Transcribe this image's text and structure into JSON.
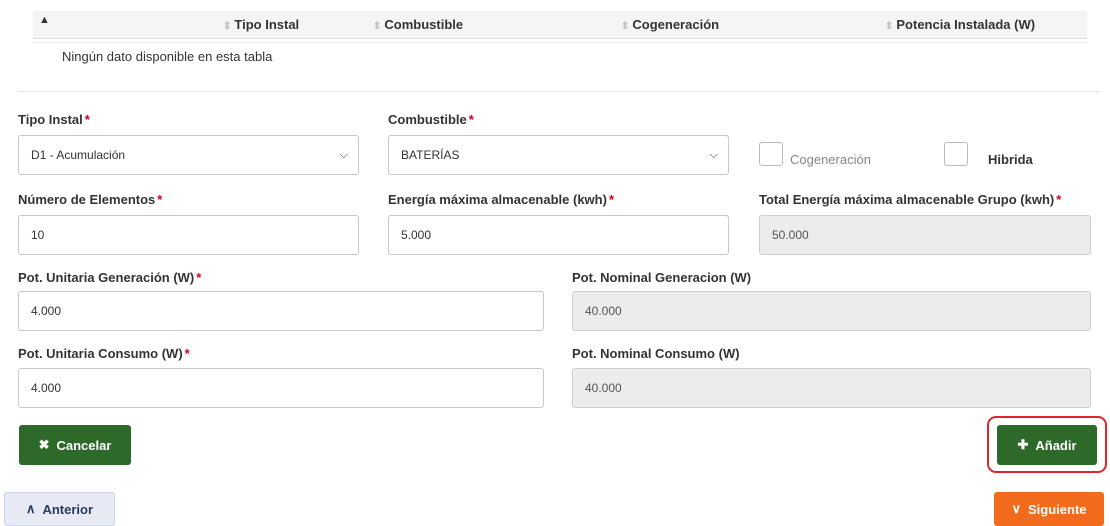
{
  "table": {
    "columns": [
      "Tipo Instal",
      "Combustible",
      "Cogeneración",
      "Potencia Instalada (W)"
    ],
    "empty_message": "Ningún dato disponible en esta tabla"
  },
  "form": {
    "tipo_instal": {
      "label": "Tipo Instal",
      "value": "D1 - Acumulación"
    },
    "combustible": {
      "label": "Combustible",
      "value": "BATERÍAS"
    },
    "cogeneracion": {
      "label": "Cogeneración",
      "checked": false
    },
    "hibrida": {
      "label": "Hibrida",
      "checked": false
    },
    "numero_elementos": {
      "label": "Número de Elementos",
      "value": "10"
    },
    "energia_maxima": {
      "label": "Energía máxima almacenable (kwh)",
      "value": "5.000"
    },
    "total_energia": {
      "label": "Total Energía máxima almacenable Grupo (kwh)",
      "value": "50.000"
    },
    "pot_unit_gen": {
      "label": "Pot. Unitaria Generación (W)",
      "value": "4.000"
    },
    "pot_nom_gen": {
      "label": "Pot. Nominal Generacion (W)",
      "value": "40.000"
    },
    "pot_unit_cons": {
      "label": "Pot. Unitaria Consumo (W)",
      "value": "4.000"
    },
    "pot_nom_cons": {
      "label": "Pot. Nominal Consumo (W)",
      "value": "40.000"
    },
    "required_mark": "*"
  },
  "buttons": {
    "cancelar": "Cancelar",
    "anadir": "Añadir",
    "anterior": "Anterior",
    "siguiente": "Siguiente"
  },
  "icons": {
    "cancel": "x-icon",
    "add": "plus-icon",
    "prev": "chevron-up-icon",
    "next": "chevron-down-icon"
  },
  "colors": {
    "primary_green": "#2d6a2a",
    "accent_orange": "#f26a1b",
    "highlight_red": "#e0262a",
    "required_red": "#d0021b"
  }
}
